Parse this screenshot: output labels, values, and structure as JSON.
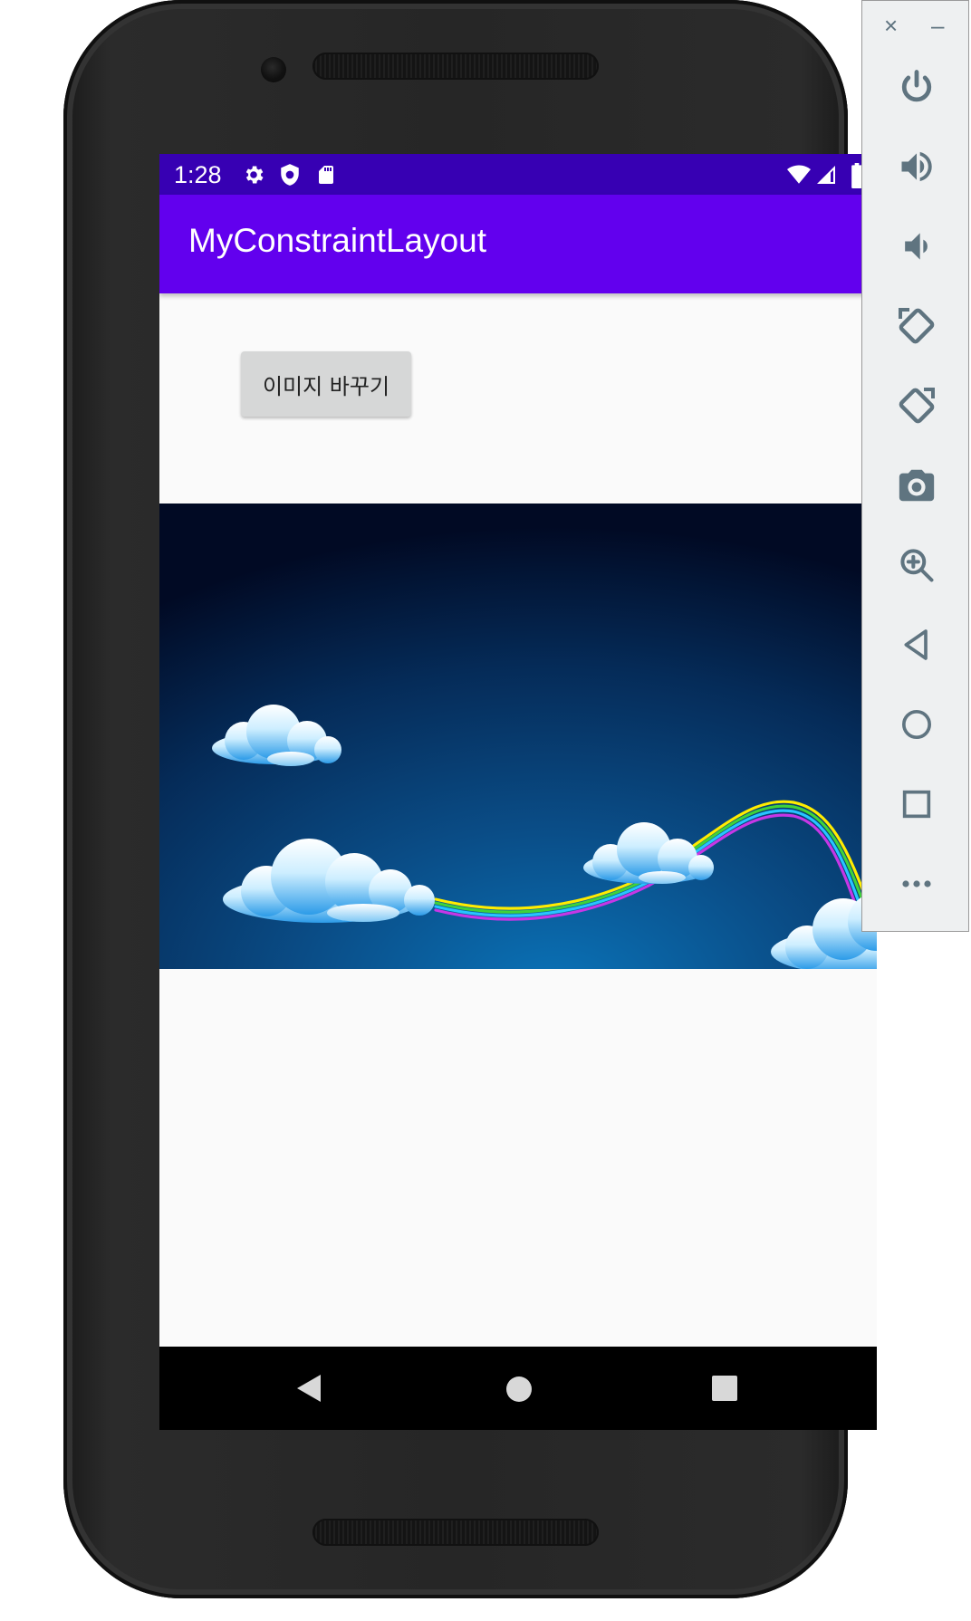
{
  "status_bar": {
    "time": "1:28",
    "icons": [
      "settings-icon",
      "shield-icon",
      "sd-card-icon",
      "wifi-icon",
      "cell-signal-icon",
      "battery-icon"
    ]
  },
  "app_bar": {
    "title": "MyConstraintLayout"
  },
  "main": {
    "change_image_button": "이미지 바꾸기",
    "image": {
      "description_icon": "night-sky-clouds-rainbow-image"
    }
  },
  "nav_bar": {
    "items": [
      "back-icon",
      "home-icon",
      "recents-icon"
    ]
  },
  "emulator_toolbar": {
    "close_label": "×",
    "minimize_label": "–",
    "items": [
      "power-icon",
      "volume-up-icon",
      "volume-down-icon",
      "rotate-left-icon",
      "rotate-right-icon",
      "camera-icon",
      "zoom-icon",
      "back-icon",
      "home-icon",
      "overview-icon",
      "more-icon"
    ]
  },
  "colors": {
    "status_bar": "#3700b3",
    "app_bar": "#6200ee",
    "screen_bg": "#fafafa",
    "button_bg": "#d6d7d7",
    "toolbar_icon": "#5f7480"
  }
}
